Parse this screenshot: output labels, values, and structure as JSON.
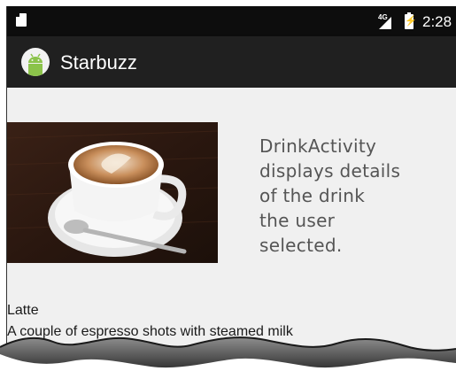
{
  "status_bar": {
    "network_label": "4G",
    "time": "2:28",
    "icons": [
      "sd-card-icon",
      "signal-icon",
      "battery-charging-icon"
    ]
  },
  "app_bar": {
    "title": "Starbuzz",
    "icon": "android-icon"
  },
  "drink": {
    "name": "Latte",
    "description": "A couple of espresso shots with steamed milk",
    "image": "latte-image"
  },
  "annotation": {
    "text": "DrinkActivity\ndisplays details\nof the drink\nthe user\nselected."
  },
  "colors": {
    "status_bar": "#0d0d0d",
    "app_bar": "#202020",
    "content_bg": "#f0f0f0",
    "android_green": "#8bc34a"
  }
}
